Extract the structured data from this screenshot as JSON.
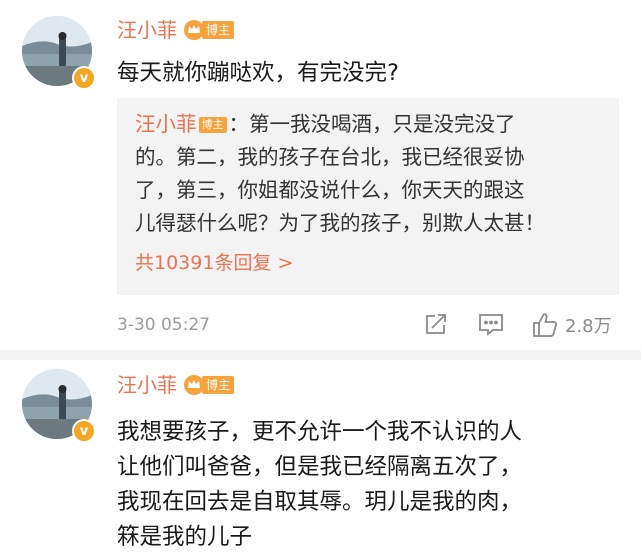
{
  "comments": [
    {
      "author": "汪小菲",
      "badge": "博主",
      "verified_mark": "v",
      "text": "每天就你蹦哒欢，有完没完?",
      "reply": {
        "author": "汪小菲",
        "badge": "博主",
        "lines": [
          "：第一我没喝酒，只是没完没了",
          "的。第二，我的孩子在台北，我已经很妥协",
          "了，第三，你姐都没说什么，你天天的跟这",
          "儿得瑟什么呢？为了我的孩子，别欺人太甚！"
        ],
        "more": "共10391条回复 >"
      },
      "timestamp": "3-30 05:27",
      "like_count": "2.8万",
      "icons": {
        "share": "share-icon",
        "reply": "comment-icon",
        "like": "thumbs-up-icon"
      }
    },
    {
      "author": "汪小菲",
      "badge": "博主",
      "verified_mark": "v",
      "lines": [
        "我想要孩子，更不允许一个我不认识的人",
        "让他们叫爸爸，但是我已经隔离五次了，",
        "我现在回去是自取其辱。玥儿是我的肉，",
        "箖是我的儿子"
      ]
    }
  ],
  "colors": {
    "name": "#eb7350",
    "badge": "#f7a23a",
    "meta": "#9a9a9a",
    "reply_bg": "#f3f3f3"
  }
}
